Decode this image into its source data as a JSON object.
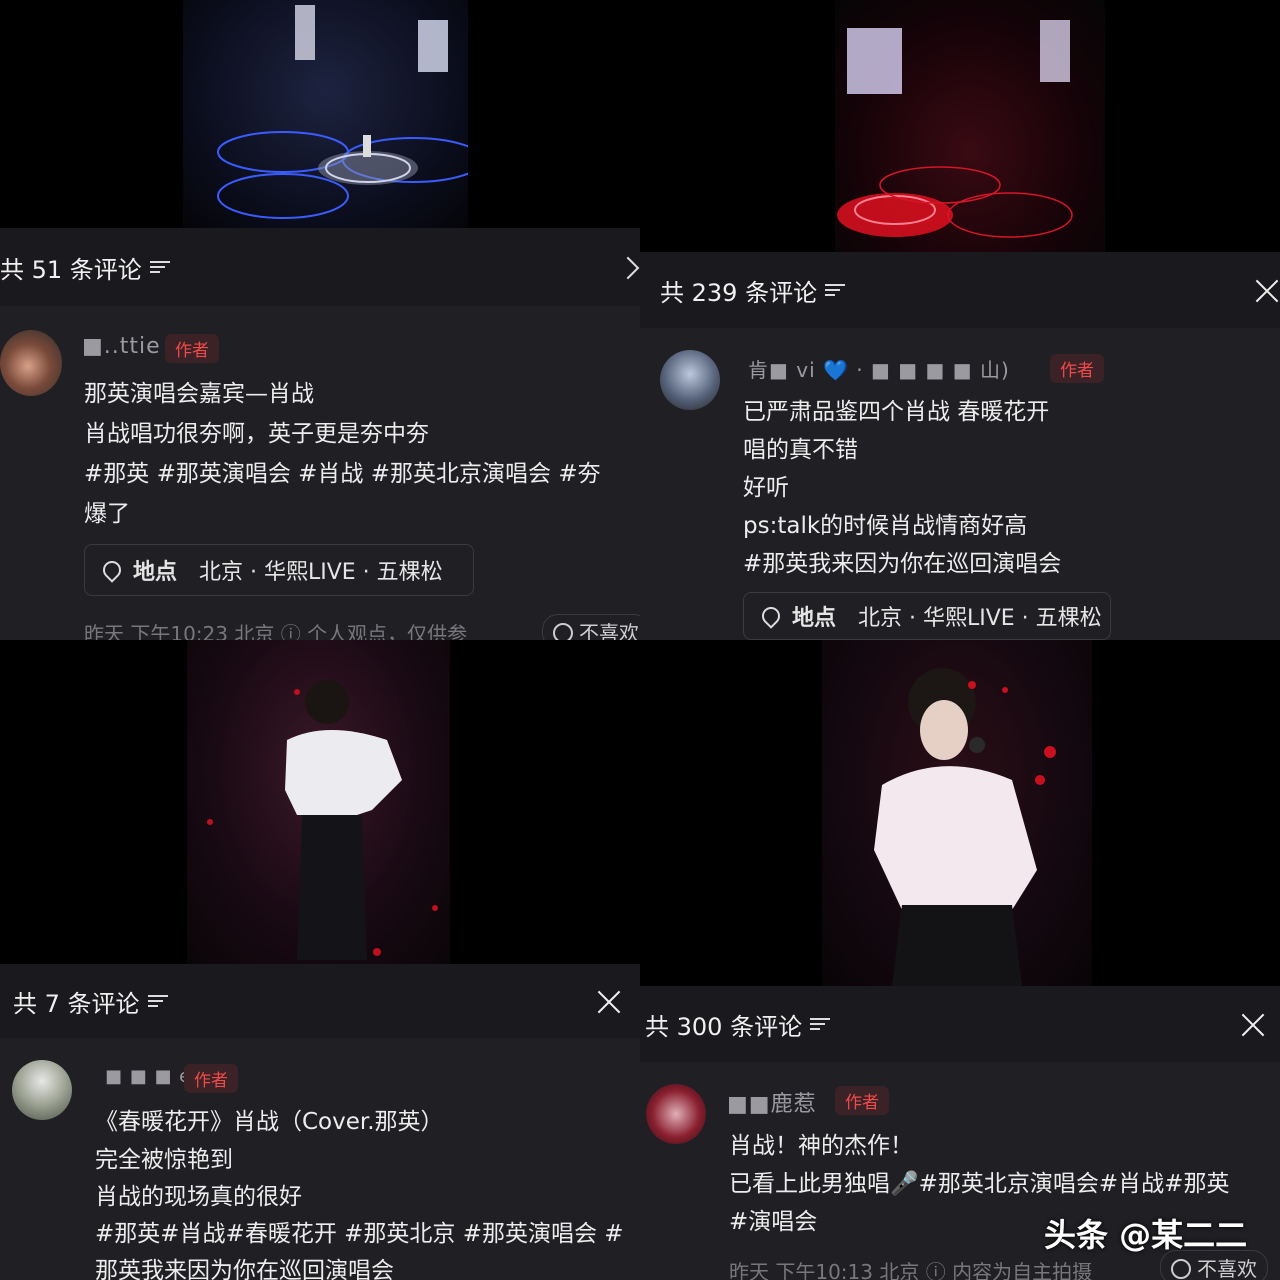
{
  "panels": [
    {
      "header": "共 51 条评论",
      "username": "■..ttie",
      "badge": "作者",
      "lines": [
        "那英演唱会嘉宾—肖战",
        "肖战唱功很夯啊，英子更是夯中夯",
        "#那英 #那英演唱会 #肖战 #那英北京演唱会 #夯",
        "爆了"
      ],
      "location_label": "地点",
      "location": "北京 · 华熙LIVE · 五棵松",
      "meta": "昨天 下午10:23 北京 ⓘ 个人观点，仅供参",
      "dislike": "不喜欢"
    },
    {
      "header": "共 239 条评论",
      "username": "肯■ vi 💙 · ■ ■ ■ ■ 山)",
      "badge": "作者",
      "lines": [
        "已严肃品鉴四个肖战 春暖花开",
        "唱的真不错",
        "好听",
        "ps:talk的时候肖战情商好高",
        "#那英我来因为你在巡回演唱会"
      ],
      "location_label": "地点",
      "location": "北京 · 华熙LIVE · 五棵松"
    },
    {
      "header": "共 7 条评论",
      "username": "■ ■ ■ e",
      "badge": "作者",
      "lines": [
        "《春暖花开》肖战（Cover.那英）",
        "完全被惊艳到",
        "肖战的现场真的很好",
        "#那英#肖战#春暖花开 #那英北京 #那英演唱会 #",
        "那英我来因为你在巡回演唱会"
      ]
    },
    {
      "header": "共 300 条评论",
      "username": "■■鹿惹",
      "badge": "作者",
      "lines": [
        "肖战！神的杰作！",
        "已看上此男独唱🎤#那英北京演唱会#肖战#那英",
        "#演唱会"
      ],
      "meta": "昨天 下午10:13 北京 ⓘ 内容为自主拍摄",
      "dislike": "不喜欢"
    }
  ],
  "watermark": "头条 @某二二",
  "colors": {
    "panel_bg": "#1f1f24",
    "header_bg": "#1a1a1e",
    "badge_text": "#f04a4a",
    "stage_red": "#e01020",
    "stage_blue": "#3a5cff"
  }
}
